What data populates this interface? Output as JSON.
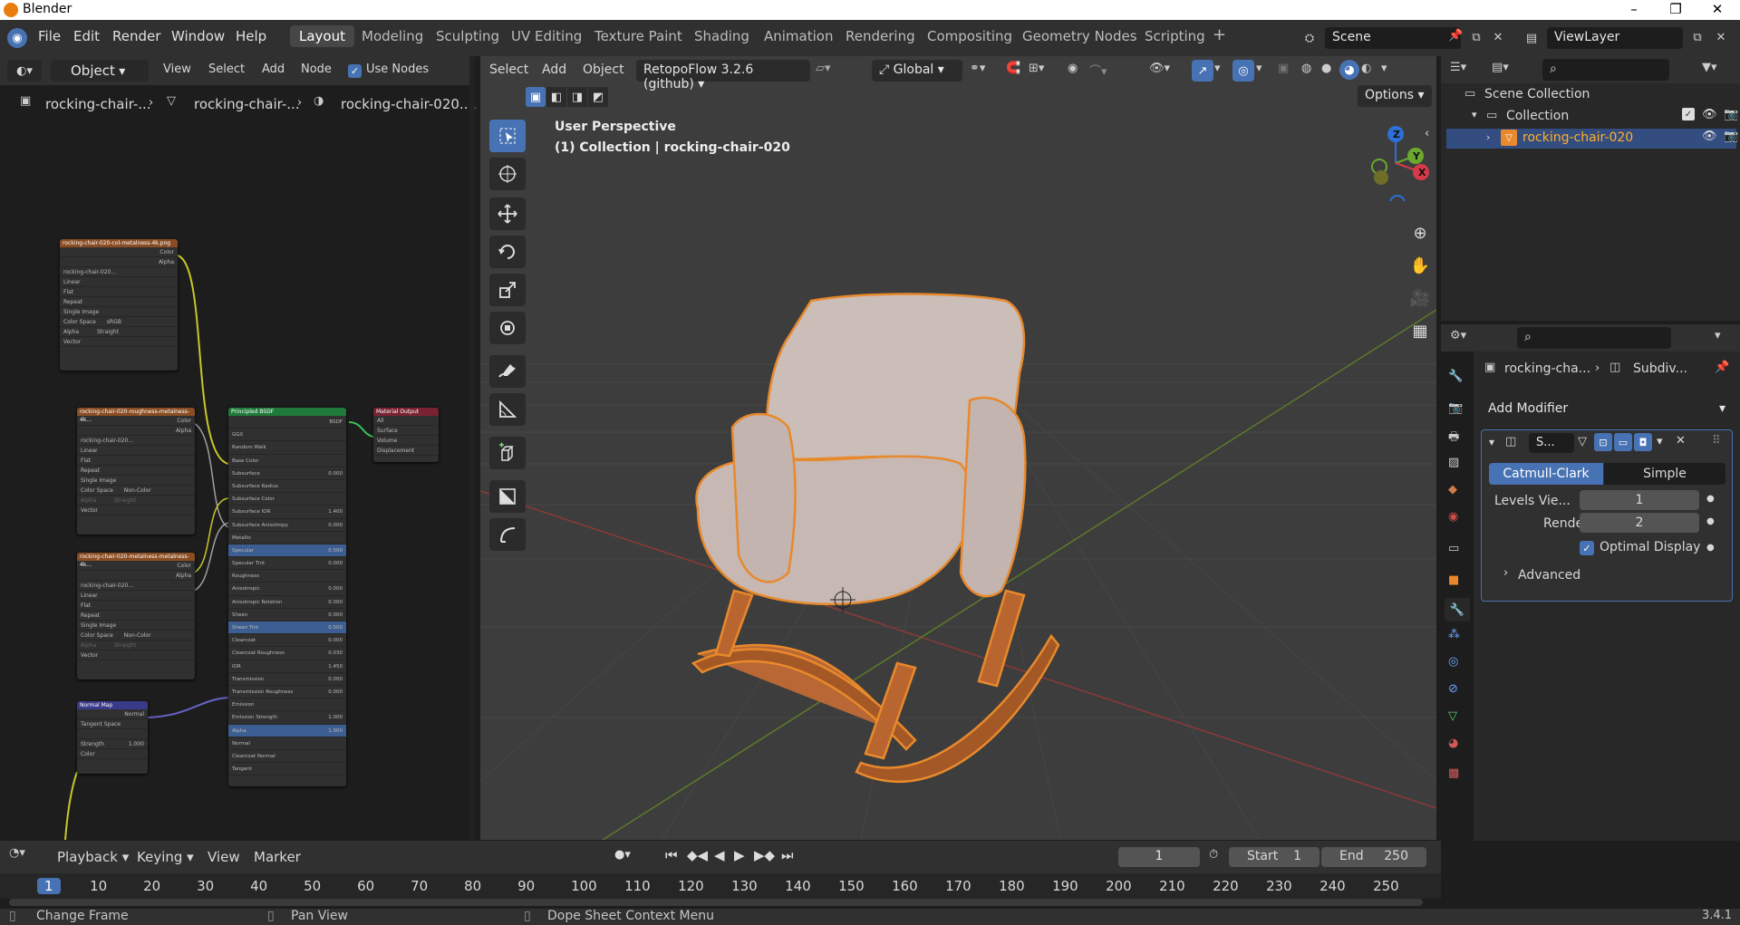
{
  "window": {
    "title": "Blender",
    "min": "–",
    "max": "❐",
    "close": "✕"
  },
  "menu": [
    "File",
    "Edit",
    "Render",
    "Window",
    "Help"
  ],
  "workspaces": [
    "Layout",
    "Modeling",
    "Sculpting",
    "UV Editing",
    "Texture Paint",
    "Shading",
    "Animation",
    "Rendering",
    "Compositing",
    "Geometry Nodes",
    "Scripting"
  ],
  "add_workspace": "+",
  "scene": {
    "name": "Scene",
    "view_layer": "ViewLayer"
  },
  "node_editor": {
    "mode": "Object",
    "menus": [
      "View",
      "Select",
      "Add",
      "Node"
    ],
    "use_nodes_label": "Use Nodes",
    "breadcrumb": [
      "rocking-chair-...",
      "rocking-chair-...",
      "rocking-chair-020...."
    ],
    "nodes": {
      "tex1_title": "rocking-chair-020-col-metalness-4k.png",
      "tex2_title": "rocking-chair-020-roughness-metalness-4k...",
      "tex3_title": "rocking-chair-020-metalness-metalness-4k...",
      "bsdf_title": "Principled BSDF",
      "output_title": "Material Output",
      "normal_title": "Normal Map",
      "tex_rows": [
        "Color",
        "Alpha",
        "rocking-chair-020...",
        "Linear",
        "Flat",
        "Repeat",
        "Single Image",
        "Color Space",
        "Alpha",
        "Vector"
      ],
      "tex1_colorspace": "sRGB",
      "tex1_alpha": "Straight",
      "tex_colorspace": "Non-Color",
      "tex_alpha": "Straight",
      "bsdf_rows": [
        "BSDF",
        "GGX",
        "Random Walk",
        "Base Color",
        "Subsurface",
        "Subsurface Radius",
        "Subsurface Color",
        "Subsurface IOR",
        "Subsurface Anisotropy",
        "Metallic",
        "Specular",
        "Specular Tint",
        "Roughness",
        "Anisotropic",
        "Anisotropic Rotation",
        "Sheen",
        "Sheen Tint",
        "Clearcoat",
        "Clearcoat Roughness",
        "IOR",
        "Transmission",
        "Transmission Roughness",
        "Emission",
        "Emission Strength",
        "Alpha",
        "Normal",
        "Clearcoat Normal",
        "Tangent"
      ],
      "bsdf_values": [
        "",
        "",
        "",
        "",
        "0.000",
        "",
        "",
        "1.400",
        "0.000",
        "",
        "0.500",
        "0.000",
        "",
        "0.000",
        "0.000",
        "0.000",
        "0.500",
        "0.000",
        "0.030",
        "1.450",
        "0.000",
        "0.000",
        "",
        "1.000",
        "1.000",
        "",
        "",
        ""
      ],
      "output_rows": [
        "All",
        "Surface",
        "Volume",
        "Displacement"
      ],
      "normal_rows": [
        "Normal",
        "Tangent Space",
        "",
        "Strength",
        "Color"
      ],
      "normal_strength": "1.000"
    }
  },
  "viewport": {
    "menus": [
      "Select",
      "Add",
      "Object"
    ],
    "addon": "RetopoFlow 3.2.6 (github)",
    "orientation": "Global",
    "options": "Options",
    "perspective": "User Perspective",
    "collection_info": "(1) Collection | rocking-chair-020",
    "gizmo_axes": {
      "x": "X",
      "y": "Y",
      "z": "Z"
    }
  },
  "outliner": {
    "scene_collection": "Scene Collection",
    "collection": "Collection",
    "object": "rocking-chair-020"
  },
  "properties": {
    "breadcrumb_obj": "rocking-cha...",
    "breadcrumb_mod": "Subdiv...",
    "add_modifier": "Add Modifier",
    "modifier_name": "S...",
    "catmull": "Catmull-Clark",
    "simple": "Simple",
    "levels_label": "Levels Vie...",
    "levels_value": "1",
    "render_label": "Render",
    "render_value": "2",
    "optimal_display": "Optimal Display",
    "advanced": "Advanced",
    "version": "3.4.1"
  },
  "timeline": {
    "menus": [
      "Playback",
      "Keying",
      "View",
      "Marker"
    ],
    "current_frame": "1",
    "start_label": "Start",
    "start": "1",
    "end_label": "End",
    "end": "250",
    "ruler": [
      "1",
      "10",
      "20",
      "30",
      "40",
      "50",
      "60",
      "70",
      "80",
      "90",
      "100",
      "110",
      "120",
      "130",
      "140",
      "150",
      "160",
      "170",
      "180",
      "190",
      "200",
      "210",
      "220",
      "230",
      "240",
      "250"
    ]
  },
  "status": {
    "left": "Change Frame",
    "mid": "Pan View",
    "right": "Dope Sheet Context Menu"
  },
  "colors": {
    "accent": "#4772b3",
    "selected_outline": "#e8892c",
    "ui_bg": "#303030"
  }
}
